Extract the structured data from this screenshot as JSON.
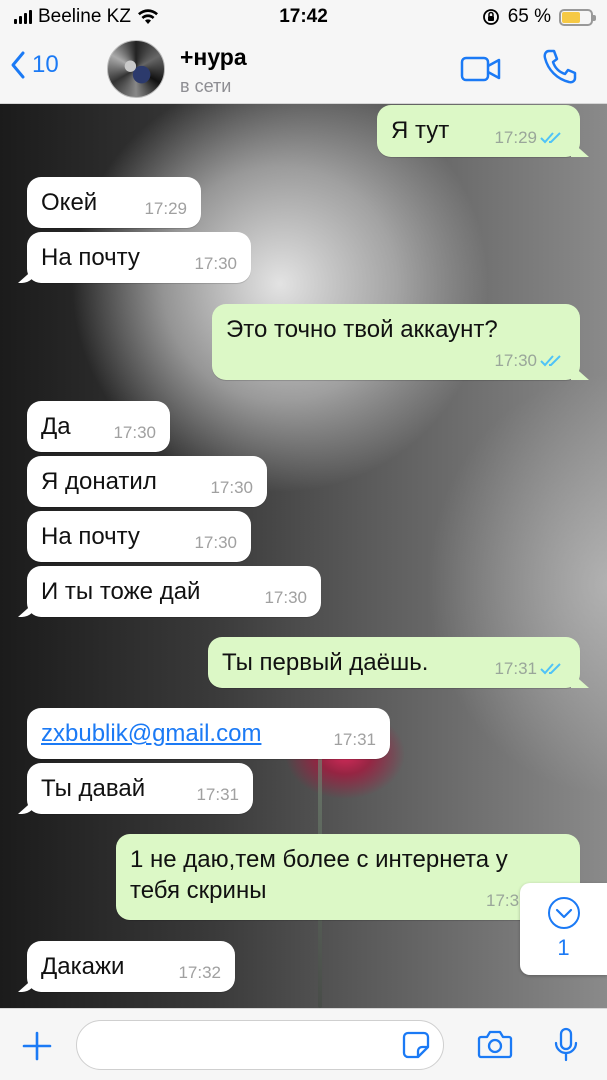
{
  "status_bar": {
    "carrier": "Beeline KZ",
    "time": "17:42",
    "battery_percent": "65 %",
    "battery_level": 0.65
  },
  "header": {
    "back_count": "10",
    "contact_name": "+нура",
    "contact_status": "в сети",
    "icons": [
      "chevron-left-icon",
      "video-call-icon",
      "phone-icon"
    ],
    "accent_color": "#1b7af5"
  },
  "messages": [
    {
      "dir": "out",
      "text": "Я тут",
      "time": "17:29",
      "read": true
    },
    {
      "dir": "in",
      "text": "Окей",
      "time": "17:29"
    },
    {
      "dir": "in",
      "text": "На почту",
      "time": "17:30"
    },
    {
      "dir": "out",
      "text": "Это точно твой аккаунт?",
      "time": "17:30",
      "read": true
    },
    {
      "dir": "in",
      "text": "Да",
      "time": "17:30"
    },
    {
      "dir": "in",
      "text": "Я донатил",
      "time": "17:30"
    },
    {
      "dir": "in",
      "text": "На почту",
      "time": "17:30"
    },
    {
      "dir": "in",
      "text": "И ты тоже дай",
      "time": "17:30"
    },
    {
      "dir": "out",
      "text": "Ты первый даёшь.",
      "time": "17:31",
      "read": true
    },
    {
      "dir": "in",
      "text": "zxbublik@gmail.com",
      "time": "17:31",
      "link": true
    },
    {
      "dir": "in",
      "text": "Ты давай",
      "time": "17:31"
    },
    {
      "dir": "out",
      "text": "1 не даю,тем более с интернета у тебя скрины",
      "time": "17:3",
      "read": false
    },
    {
      "dir": "in",
      "text": "Дакажи",
      "time": "17:32"
    }
  ],
  "scroll_button": {
    "unread_count": "1",
    "icon": "chevron-down-circle-icon"
  },
  "input_bar": {
    "value": "",
    "icons": [
      "plus-icon",
      "sticker-icon",
      "camera-icon",
      "microphone-icon"
    ]
  },
  "colors": {
    "incoming_bubble": "#ffffff",
    "outgoing_bubble": "#dcf8c6",
    "read_ticks": "#4fc3f7"
  }
}
